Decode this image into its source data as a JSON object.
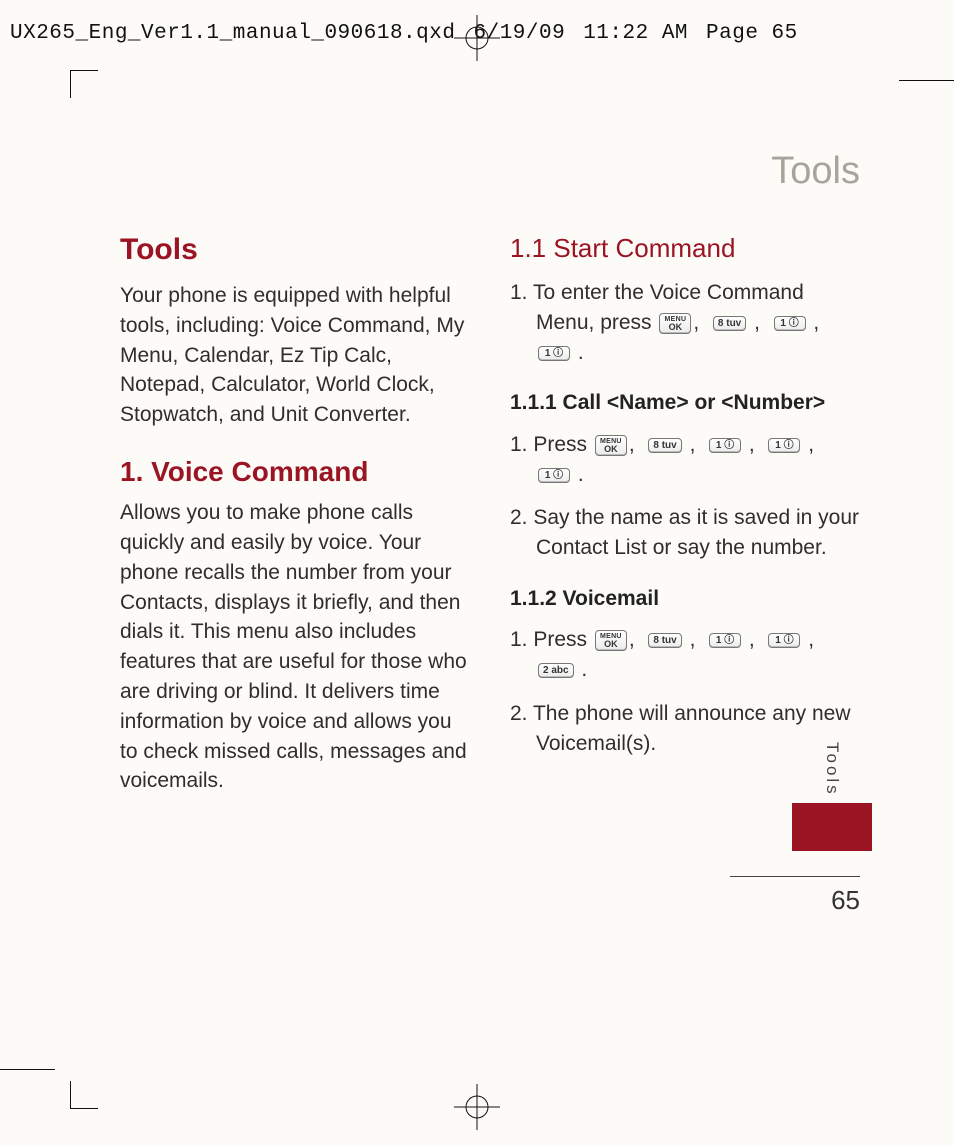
{
  "print_header": {
    "file": "UX265_Eng_Ver1.1_manual_090618.qxd",
    "date": "6/19/09",
    "time": "11:22 AM",
    "page": "Page 65"
  },
  "running_head": "Tools",
  "side_tab": "Tools",
  "page_number": "65",
  "left": {
    "h_tools": "Tools",
    "p_tools": "Your phone is equipped with helpful tools, including: Voice Command, My Menu, Calendar, Ez Tip Calc, Notepad, Calculator, World Clock, Stopwatch, and Unit Converter.",
    "h_voice": "1. Voice Command",
    "p_voice": "Allows you to make phone calls quickly and easily by voice. Your phone recalls the number from your Contacts, displays it briefly, and then dials it. This menu also includes features that are useful for those who are driving or blind. It delivers time information by voice and allows you to check missed calls, messages and voicemails."
  },
  "right": {
    "h_11": "1.1 Start Command",
    "s11_item1_a": "1. To enter the Voice Command Menu, press ",
    "h_111": "1.1.1 Call <Name> or <Number>",
    "s111_item1_a": "1. Press ",
    "s111_item2": "2. Say the name as it is saved in your Contact List or say the number.",
    "h_112": "1.1.2 Voicemail",
    "s112_item1_a": "1. Press ",
    "s112_item2": "2. The phone will announce any new Voicemail(s)."
  },
  "keys": {
    "ok_top": "MENU",
    "ok_bot": "OK",
    "k8": "8 tuv",
    "k1": "1 ⓘ",
    "k2": "2 abc"
  }
}
